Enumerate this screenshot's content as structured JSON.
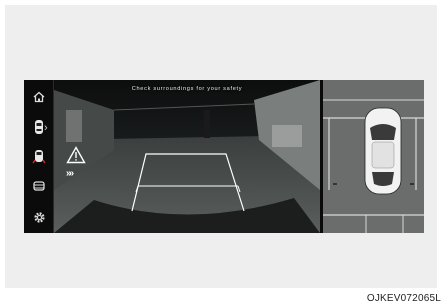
{
  "camera": {
    "message": "Check surroundings for your safety"
  },
  "sidebar": {
    "items": [
      {
        "icon": "home-icon"
      },
      {
        "icon": "car-view-icon"
      },
      {
        "icon": "rear-view-icon"
      },
      {
        "icon": "parking-view-icon"
      },
      {
        "icon": "gear-icon"
      }
    ],
    "chevron": "›"
  },
  "indicators": {
    "warning_icon": "warning-triangle-icon",
    "direction_arrows": "»»"
  },
  "caption": "OJKEV072065L",
  "colors": {
    "guide_lines": "#ffffff",
    "topview_ground": "#6b6d6d",
    "car_body": "#f2f2f2"
  }
}
